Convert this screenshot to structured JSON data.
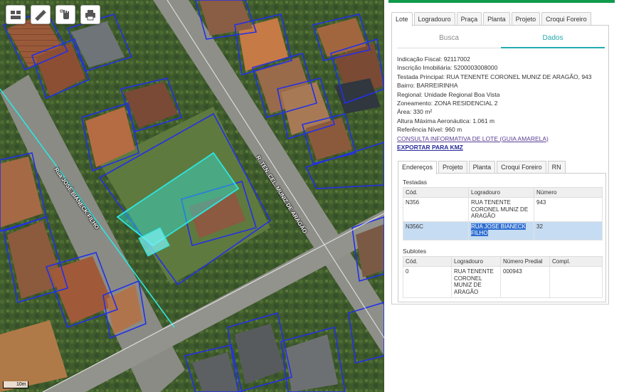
{
  "map": {
    "tools": [
      {
        "icon": "layers-icon"
      },
      {
        "icon": "ruler-icon"
      },
      {
        "icon": "hand-select-icon"
      },
      {
        "icon": "printer-icon"
      }
    ],
    "street_labels": [
      "Rua JOSÉ BIANECK FILHO",
      "R. TEN. CEL. MUNIZ DE ARAGÃO"
    ],
    "scale_label": "10m",
    "colors": {
      "lot_outline": "#2330e8",
      "selected_lot": "#2ee6e0"
    }
  },
  "panel": {
    "top_tabs": [
      "Lote",
      "Logradouro",
      "Praça",
      "Planta",
      "Projeto",
      "Croqui Foreiro"
    ],
    "active_top_tab": "Lote",
    "sub_tabs": [
      "Busca",
      "Dados"
    ],
    "active_sub_tab": "Dados",
    "accent_color": "#24aab0",
    "info": [
      {
        "label": "Indicação Fiscal:",
        "value": "92117002"
      },
      {
        "label": "Inscrição Imobiliária:",
        "value": "5200003008000"
      },
      {
        "label": "Testada Principal:",
        "value": "RUA TENENTE CORONEL MUNIZ DE ARAGÃO, 943"
      },
      {
        "label": "Bairro:",
        "value": "BARREIRINHA"
      },
      {
        "label": "Regional:",
        "value": "Unidade Regional Boa Vista"
      },
      {
        "label": "Zoneamento:",
        "value": "ZONA RESIDENCIAL 2"
      },
      {
        "label": "Área:",
        "value": "330 m²"
      },
      {
        "label": "Altura Máxima Aeronáutica:",
        "value": "1.061 m"
      },
      {
        "label": "Referência Nível:",
        "value": "960 m"
      }
    ],
    "link_consulta": "CONSULTA INFORMATIVA DE LOTE (GUIA AMARELA)",
    "link_kmz": "EXPORTAR PARA KMZ",
    "bottom_tabs": [
      "Endereços",
      "Projeto",
      "Planta",
      "Croqui Foreiro",
      "RN"
    ],
    "active_bottom_tab": "Endereços",
    "testadas": {
      "title": "Testadas",
      "headers": [
        "Cód.",
        "Logradouro",
        "Número"
      ],
      "rows": [
        {
          "cod": "N356",
          "logradouro": "RUA TENENTE CORONEL MUNIZ DE ARAGÃO",
          "numero": "943",
          "selected": false
        },
        {
          "cod": "N356C",
          "logradouro": "RUA JOSE BIANECK FILHO",
          "numero": "32",
          "selected": true
        }
      ]
    },
    "sublotes": {
      "title": "Sublotes",
      "headers": [
        "Cód.",
        "Logradouro",
        "Número Predial",
        "Compl."
      ],
      "rows": [
        {
          "cod": "0",
          "logradouro": "RUA TENENTE CORONEL MUNIZ DE ARAGÃO",
          "numero": "000943",
          "compl": ""
        }
      ]
    }
  }
}
